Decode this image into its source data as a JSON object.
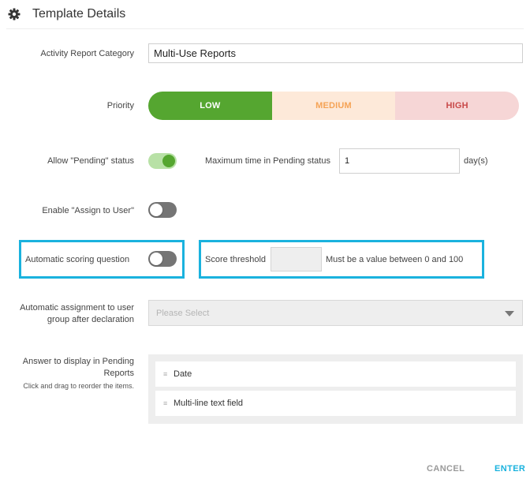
{
  "header": {
    "title": "Template Details",
    "icon": "gear-icon"
  },
  "form": {
    "category": {
      "label": "Activity Report Category",
      "value": "Multi-Use Reports"
    },
    "priority": {
      "label": "Priority",
      "options": [
        "LOW",
        "MEDIUM",
        "HIGH"
      ],
      "selected": "LOW",
      "colors": {
        "low": "#55a630",
        "medium": "#fde9d9",
        "high": "#f6d6d6"
      }
    },
    "pending": {
      "label": "Allow \"Pending\" status",
      "enabled": true,
      "max_time_label": "Maximum time in Pending status",
      "max_time_value": "1",
      "unit": "day(s)"
    },
    "assign_user": {
      "label": "Enable \"Assign to User\"",
      "enabled": false
    },
    "auto_scoring": {
      "label": "Automatic scoring question",
      "enabled": false,
      "threshold_label": "Score threshold",
      "threshold_value": "",
      "hint": "Must be a value between 0 and 100"
    },
    "auto_assignment": {
      "label_line1": "Automatic assignment to user",
      "label_line2": "group after declaration",
      "placeholder": "Please Select"
    },
    "answers": {
      "label_line1": "Answer to display in Pending",
      "label_line2": "Reports",
      "help": "Click and drag to reorder the items.",
      "items": [
        "Date",
        "Multi-line text field"
      ]
    }
  },
  "actions": {
    "cancel": "CANCEL",
    "enter": "ENTER"
  },
  "accent_color": "#1ab2de"
}
